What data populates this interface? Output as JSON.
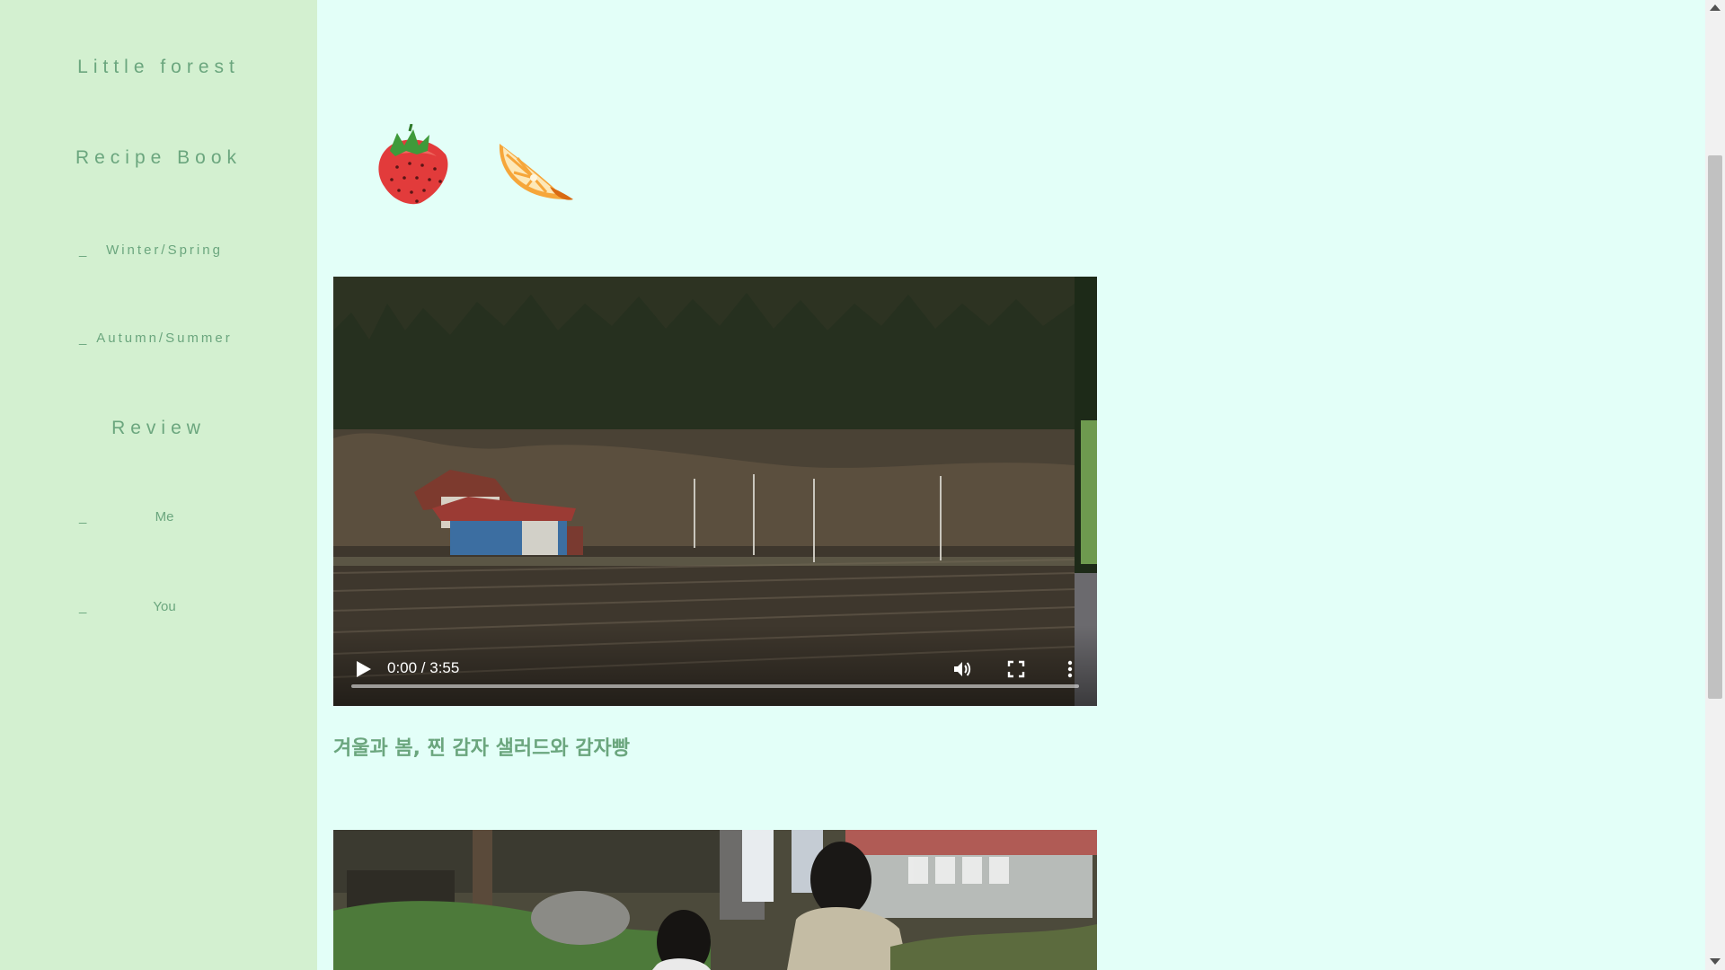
{
  "sidebar": {
    "title": "Little forest",
    "subtitle": "Recipe Book",
    "links": [
      {
        "dash": "_",
        "label": "Winter/Spring"
      },
      {
        "dash": "_",
        "label": "Autumn/Summer"
      }
    ],
    "review_heading": "Review",
    "review_links": [
      {
        "dash": "_",
        "label": "Me"
      },
      {
        "dash": "_",
        "label": "You"
      }
    ]
  },
  "fruits": [
    {
      "name": "strawberry",
      "icon": "strawberry-illustration"
    },
    {
      "name": "orange",
      "icon": "orange-slice-illustration"
    }
  ],
  "video": {
    "time": "0:00 / 3:55",
    "progress": 0,
    "icons": [
      "play-icon",
      "volume-icon",
      "fullscreen-icon",
      "more-options-icon"
    ]
  },
  "recipe": {
    "title": "겨울과 봄, 찐 감자 샐러드와 감자빵"
  },
  "colors": {
    "sidebar_bg": "#d3f0d0",
    "page_bg": "#e3fff8",
    "accent_text": "#6ba67e"
  }
}
